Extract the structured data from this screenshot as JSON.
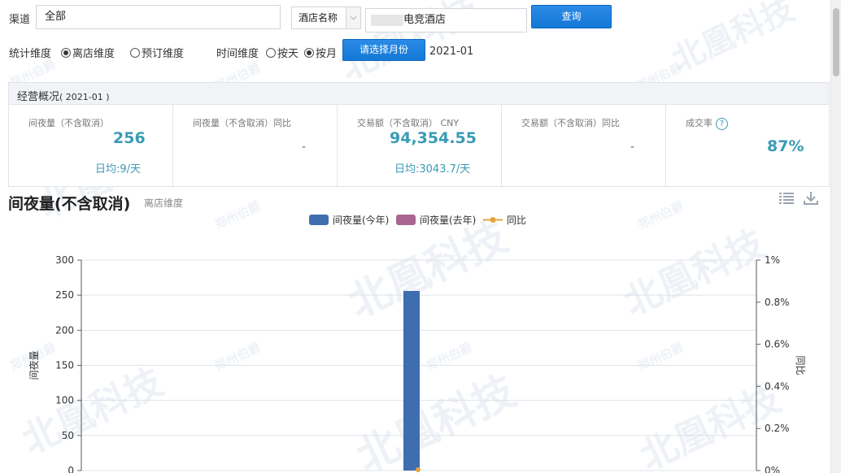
{
  "filters": {
    "channel_label": "渠道",
    "channel_value": "全部",
    "hotel_select_value": "酒店名称",
    "hotel_input_value": "电竞酒店",
    "query_button": "查询"
  },
  "dimensions": {
    "stat_label": "统计维度",
    "stat_options": [
      "离店维度",
      "预订维度"
    ],
    "stat_selected": 0,
    "time_label": "时间维度",
    "time_options": [
      "按天",
      "按月"
    ],
    "time_selected": 1,
    "month_button": "请选择月份",
    "selected_month": "2021-01"
  },
  "overview": {
    "title": "经营概况",
    "period": "( 2021-01 )",
    "cells": [
      {
        "label": "间夜量（不含取消）",
        "value": "256",
        "sub": "日均:9/天"
      },
      {
        "label": "间夜量（不含取消）同比",
        "value": "-"
      },
      {
        "label": "交易额（不含取消） CNY",
        "value": "94,354.55",
        "sub": "日均:3043.7/天"
      },
      {
        "label": "交易额（不含取消）同比",
        "value": "-"
      },
      {
        "label": "成交率",
        "value": "87%",
        "help": "?"
      }
    ]
  },
  "chart_section": {
    "title": "间夜量(不含取消)",
    "subtitle": "离店维度"
  },
  "chart_data": {
    "type": "bar",
    "title": "",
    "series": [
      {
        "name": "间夜量(今年)",
        "type": "bar",
        "color": "#3f6eb0",
        "values": [
          256
        ]
      },
      {
        "name": "间夜量(去年)",
        "type": "bar",
        "color": "#a9668e",
        "values": [
          0
        ]
      },
      {
        "name": "同比",
        "type": "line",
        "color": "#e8a33d",
        "axis": "right",
        "values": [
          0
        ]
      }
    ],
    "ylabel": "间夜量",
    "y2label": "同比",
    "ylim": [
      0,
      300
    ],
    "y2lim": [
      0,
      1
    ],
    "yticks": [
      "0",
      "50",
      "100",
      "150",
      "200",
      "250",
      "300"
    ],
    "y2ticks": [
      "0%",
      "0.2%",
      "0.4%",
      "0.6%",
      "0.8%",
      "1%"
    ],
    "grid": true,
    "legend": "top-center"
  },
  "watermark": {
    "text_large": "北凰科技",
    "text_small": "郑州伯爵"
  },
  "colors": {
    "accent": "#1478d6",
    "value": "#3a9bb5"
  }
}
